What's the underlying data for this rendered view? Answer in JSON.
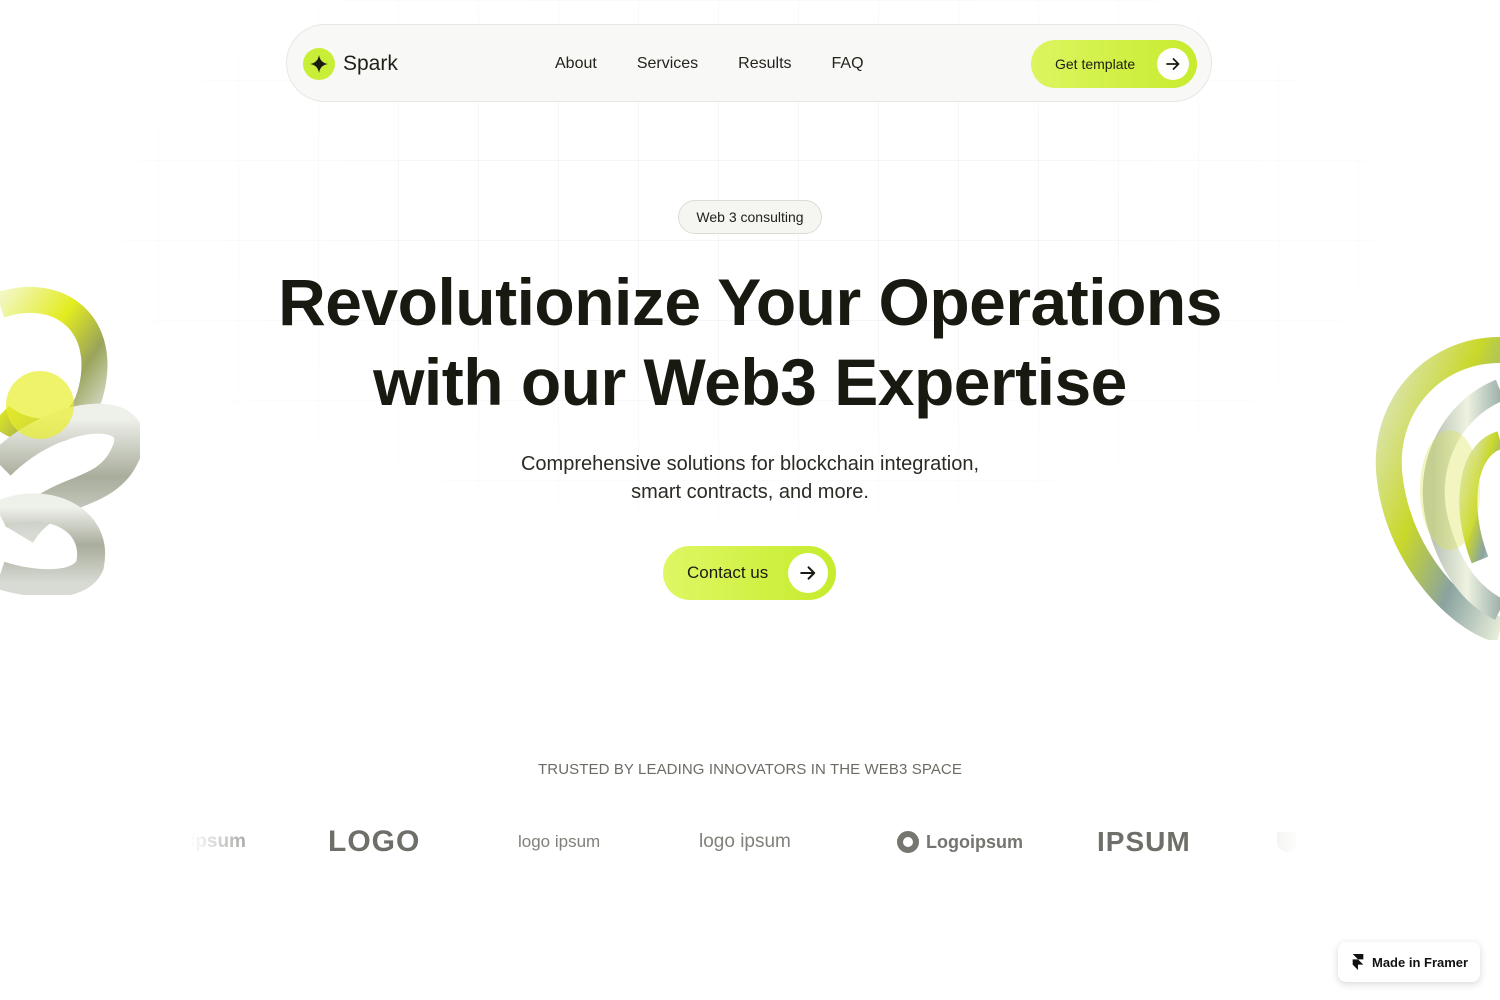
{
  "nav": {
    "brand": "Spark",
    "links": [
      "About",
      "Services",
      "Results",
      "FAQ"
    ],
    "cta_label": "Get template"
  },
  "hero": {
    "pill": "Web 3 consulting",
    "headline_line1": "Revolutionize Your Operations",
    "headline_line2": "with our Web3 Expertise",
    "subtitle_line1": "Comprehensive solutions for blockchain integration,",
    "subtitle_line2": "smart contracts, and more.",
    "cta_label": "Contact us"
  },
  "trusted": {
    "heading": "TRUSTED BY LEADING INNOVATORS IN THE WEB3 SPACE",
    "logos": [
      "ipsum",
      "LOGO",
      "logo ipsum",
      "logo ipsum",
      "Logoipsum",
      "IPSUM"
    ]
  },
  "badge": {
    "label": "Made in Framer"
  },
  "colors": {
    "accent": "#c9ee38",
    "text": "#181910",
    "muted": "#6b6c64"
  },
  "icons": [
    "sparkle-icon",
    "arrow-right-icon",
    "framer-icon"
  ]
}
